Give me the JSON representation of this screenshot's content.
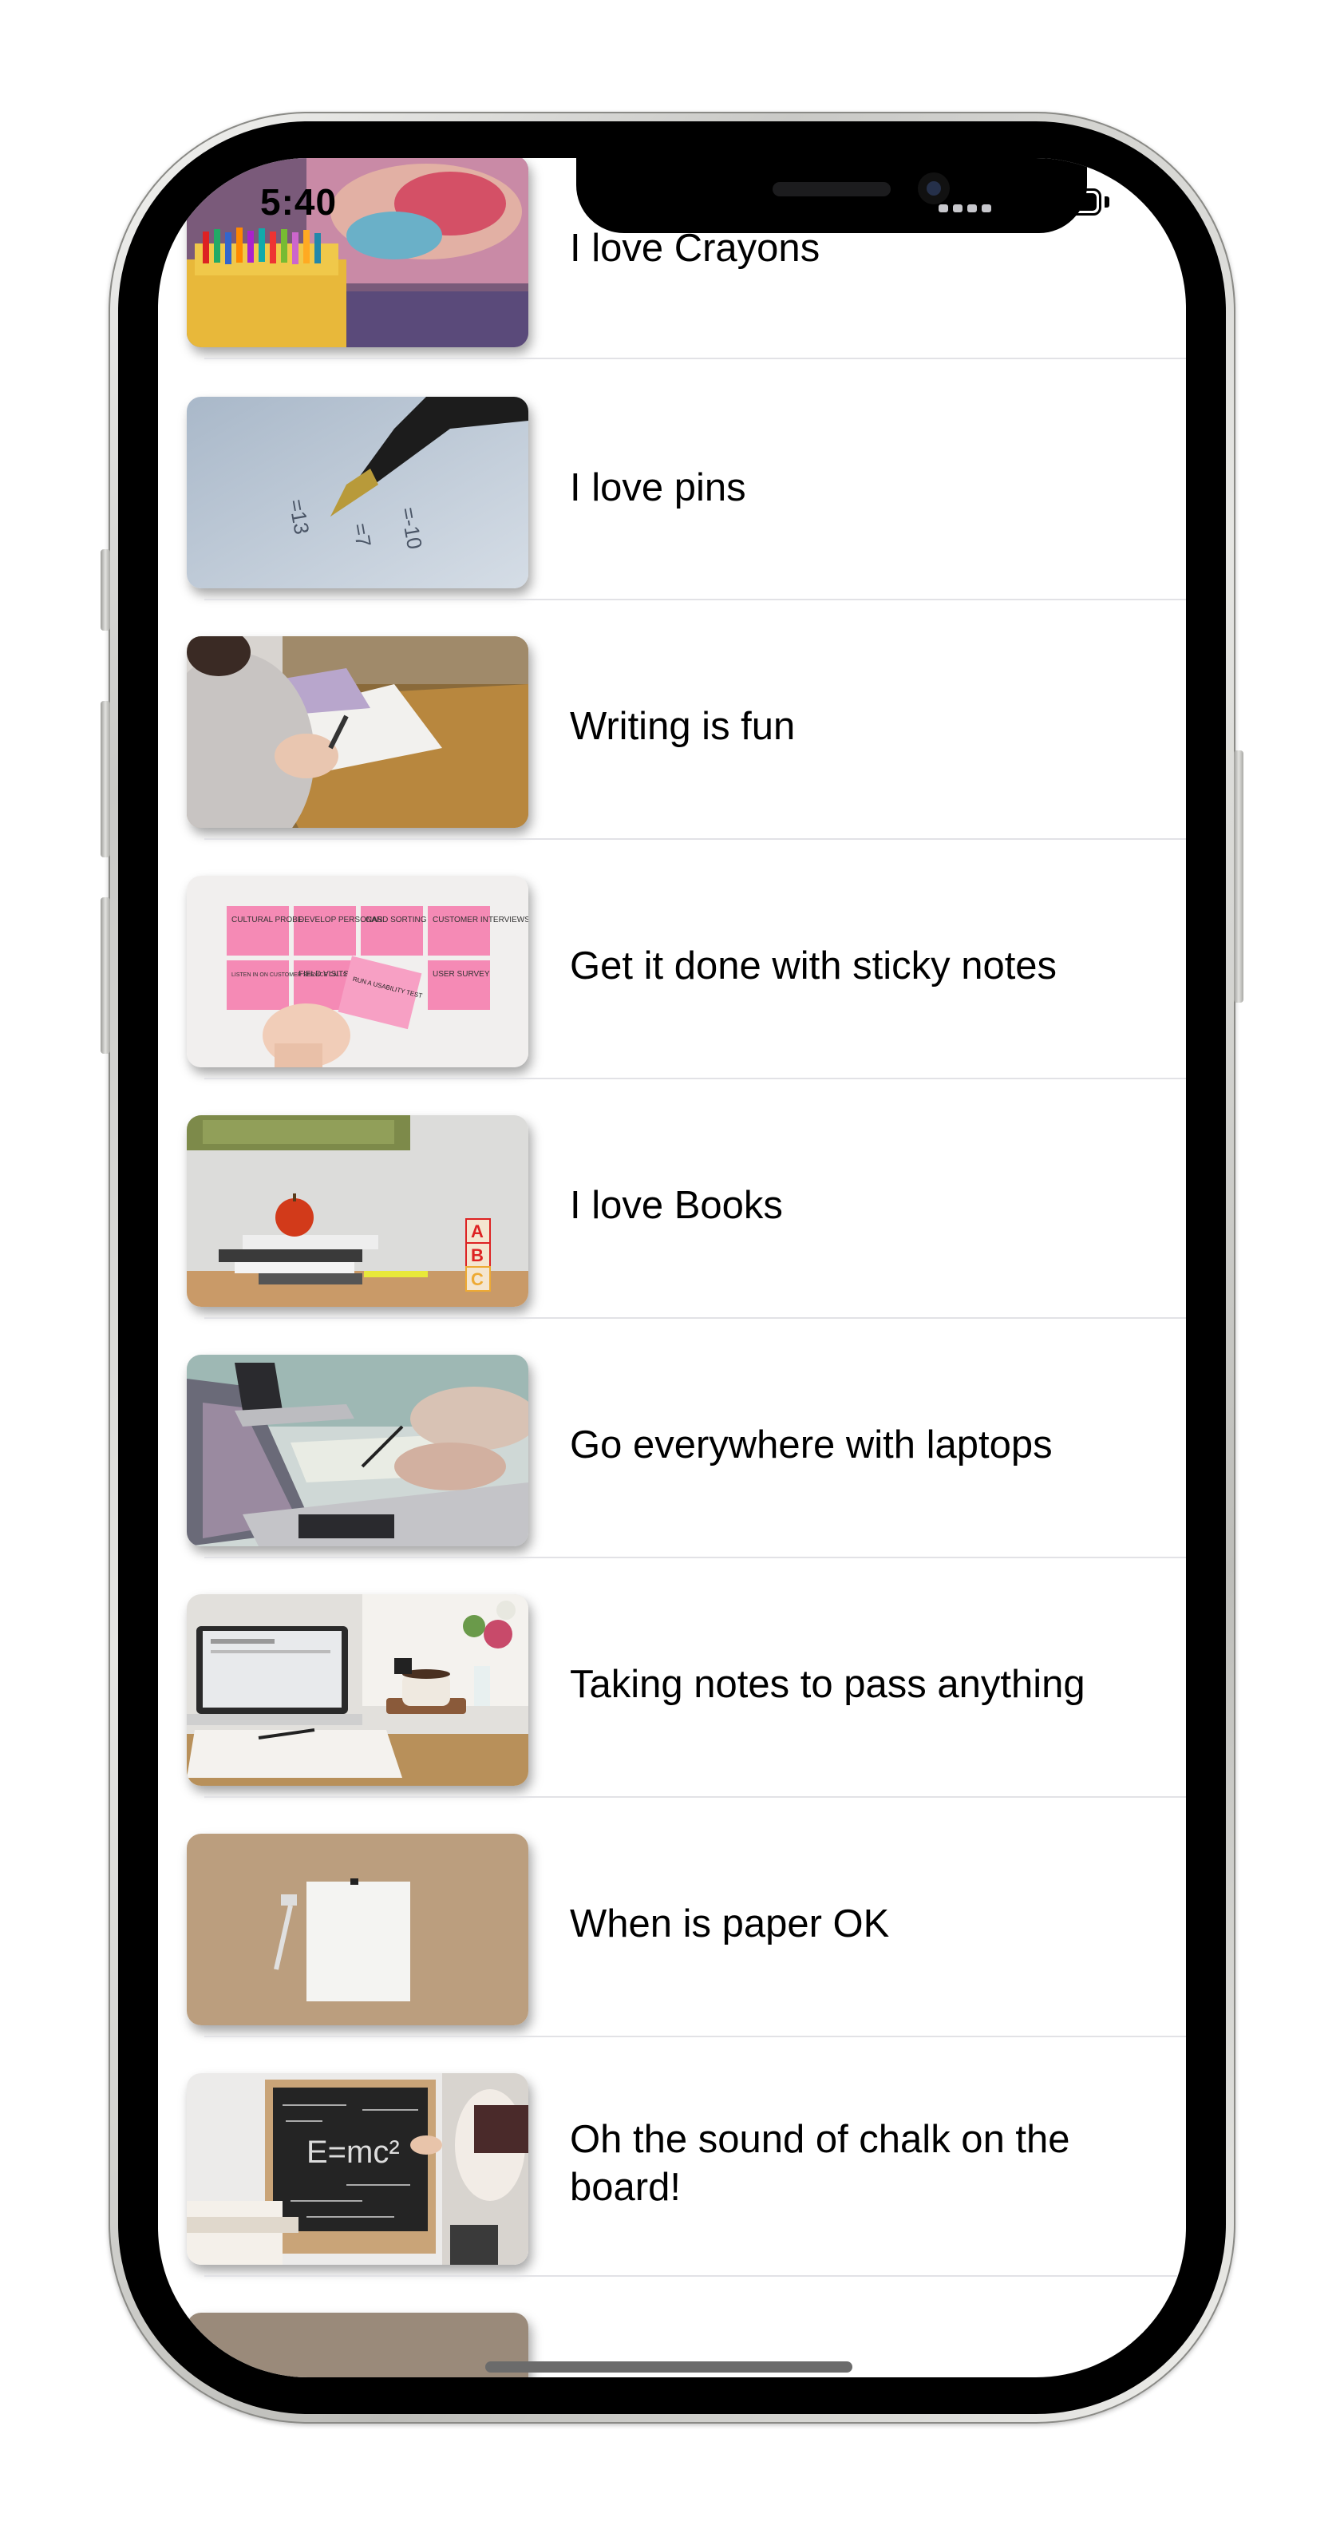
{
  "status_bar": {
    "time": "5:40"
  },
  "rows": [
    {
      "title": "I love Crayons",
      "image": "crayons-photo"
    },
    {
      "title": "I love pins",
      "image": "pen-photo"
    },
    {
      "title": "Writing is fun",
      "image": "writing-photo"
    },
    {
      "title": "Get it done with sticky notes",
      "image": "sticky-notes-photo",
      "image_text": [
        "CULTURAL PROBE",
        "DEVELOP PERSONAS",
        "CARD SORTING",
        "CUSTOMER INTERVIEWS",
        "LISTEN IN ON CUSTOMER SERVICE CALLS",
        "FIELD VISITS",
        "RUN A USABILITY TEST",
        "USER SURVEY"
      ]
    },
    {
      "title": "I love Books",
      "image": "books-apple-photo",
      "image_text": [
        "A",
        "B",
        "C"
      ]
    },
    {
      "title": "Go everywhere with laptops",
      "image": "laptops-photo"
    },
    {
      "title": "Taking notes to pass anything",
      "image": "notebook-laptop-photo"
    },
    {
      "title": "When is paper OK",
      "image": "paper-photo"
    },
    {
      "title": "Oh the sound of chalk on the board!",
      "image": "chalkboard-photo",
      "image_text": [
        "E=mc²"
      ]
    }
  ],
  "colors": {
    "accent": "#000000",
    "separator": "#e2e2e6",
    "background": "#ffffff"
  }
}
